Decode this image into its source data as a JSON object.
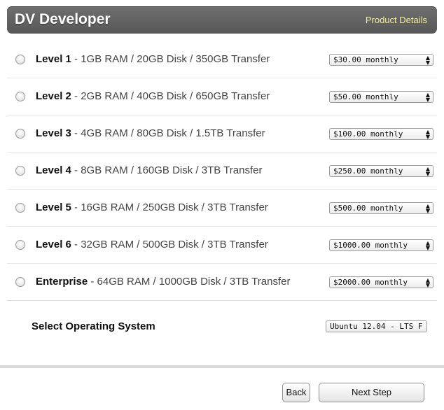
{
  "header": {
    "title": "DV Developer",
    "product_details": "Product Details"
  },
  "plans": [
    {
      "name": "Level 1",
      "spec": " - 1GB RAM / 20GB Disk / 350GB Transfer",
      "price": "$30.00 monthly"
    },
    {
      "name": "Level 2",
      "spec": " - 2GB RAM / 40GB Disk / 650GB Transfer",
      "price": "$50.00 monthly"
    },
    {
      "name": "Level 3",
      "spec": " - 4GB RAM / 80GB Disk / 1.5TB Transfer",
      "price": "$100.00 monthly"
    },
    {
      "name": "Level 4",
      "spec": " - 8GB RAM / 160GB Disk / 3TB Transfer",
      "price": "$250.00 monthly"
    },
    {
      "name": "Level 5",
      "spec": " - 16GB RAM / 250GB Disk / 3TB Transfer",
      "price": "$500.00 monthly"
    },
    {
      "name": "Level 6",
      "spec": " - 32GB RAM / 500GB Disk / 3TB Transfer",
      "price": "$1000.00 monthly"
    },
    {
      "name": "Enterprise",
      "spec": " - 64GB RAM / 1000GB Disk / 3TB Transfer",
      "price": "$2000.00 monthly"
    }
  ],
  "os": {
    "label": "Select Operating System",
    "selected": "Ubuntu 12.04 - LTS F"
  },
  "buttons": {
    "back": "Back",
    "next": "Next Step"
  },
  "colors": {
    "header_bg": "#5f5f5f",
    "header_link": "#f2eaa4"
  },
  "icons": {
    "select_arrows": "up-down-arrows-icon",
    "radio": "radio-button"
  }
}
